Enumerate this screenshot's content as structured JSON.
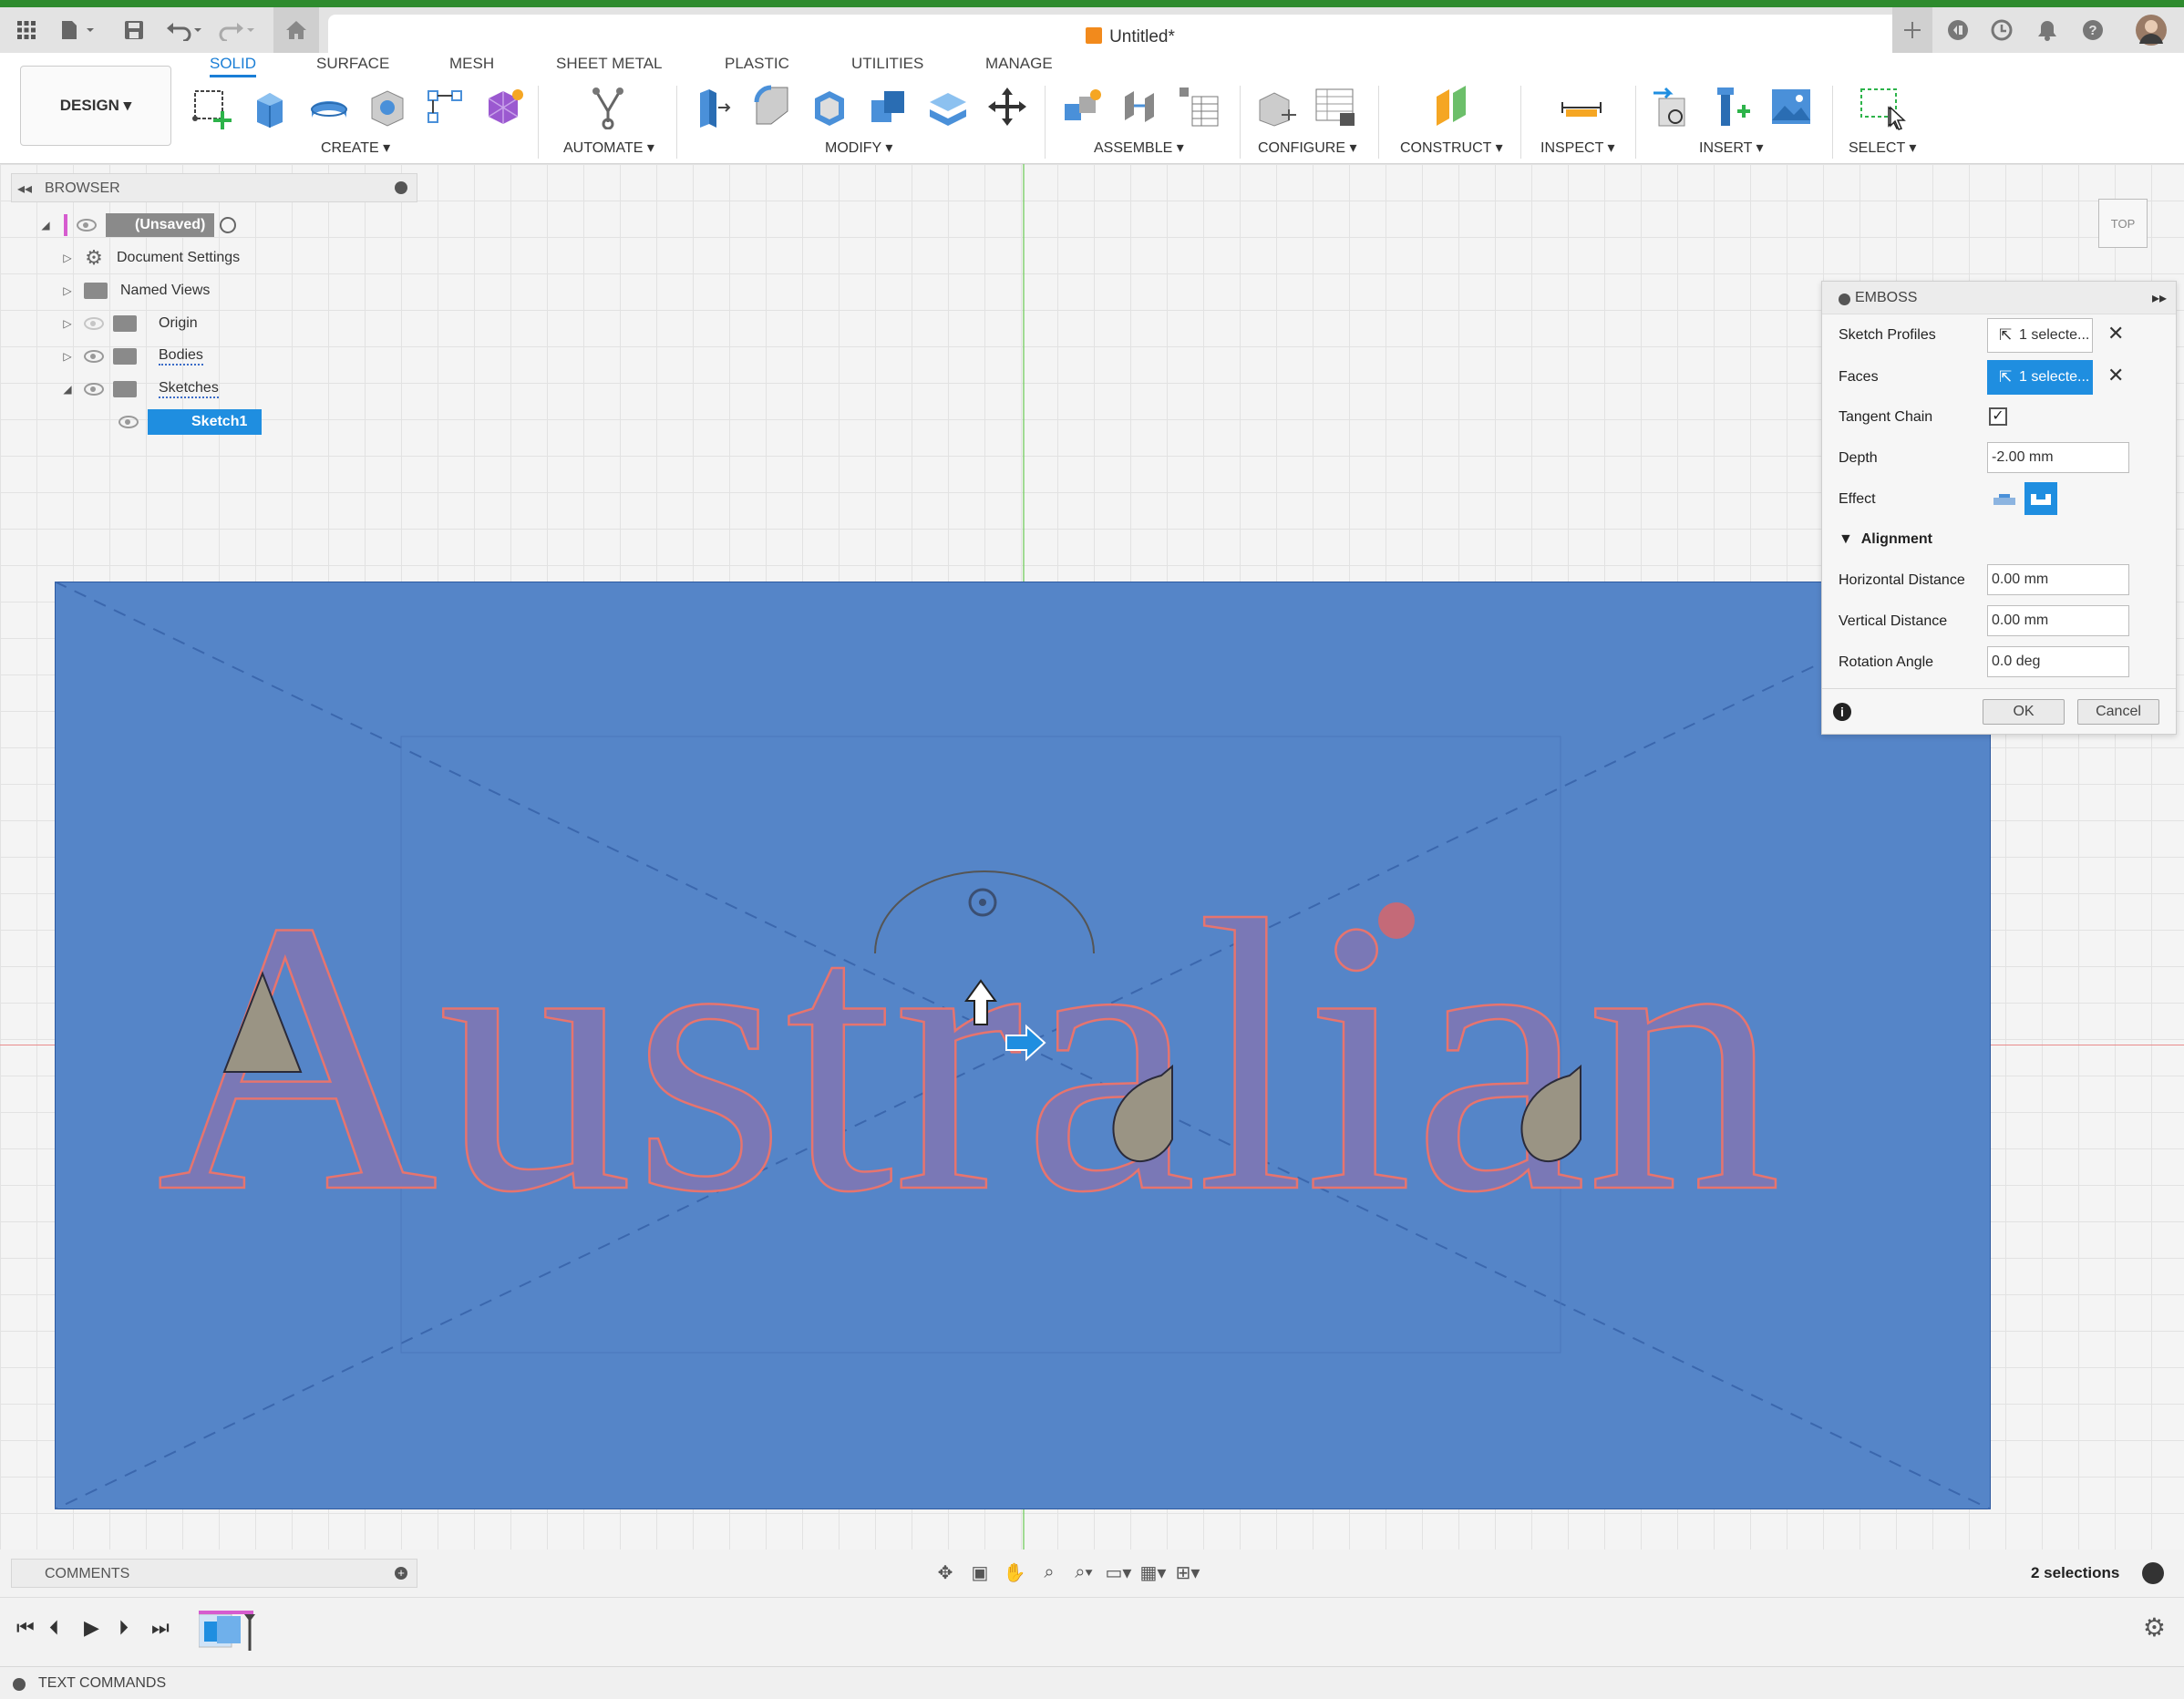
{
  "window": {
    "title": "Untitled*"
  },
  "titlebar_icons": [
    "apps-grid-icon",
    "file-icon",
    "save-icon",
    "undo-icon",
    "redo-icon",
    "home-icon",
    "new-tab-icon",
    "extensions-icon",
    "job-status-icon",
    "notifications-icon",
    "help-icon",
    "user-avatar"
  ],
  "workspace": {
    "label": "DESIGN"
  },
  "tabs": [
    "SOLID",
    "SURFACE",
    "MESH",
    "SHEET METAL",
    "PLASTIC",
    "UTILITIES",
    "MANAGE"
  ],
  "active_tab": "SOLID",
  "groups": [
    "CREATE",
    "AUTOMATE",
    "MODIFY",
    "ASSEMBLE",
    "CONFIGURE",
    "CONSTRUCT",
    "INSPECT",
    "INSERT",
    "SELECT"
  ],
  "browser": {
    "title": "BROWSER",
    "root": "(Unsaved)",
    "items": [
      "Document Settings",
      "Named Views",
      "Origin",
      "Bodies",
      "Sketches",
      "Sketch1"
    ]
  },
  "canvas": {
    "sketch_text": "Australian",
    "view_cube": "TOP",
    "plate_color": "#5585c8",
    "text_color": "#7a78b6"
  },
  "emboss": {
    "title": "EMBOSS",
    "sketch_profiles_label": "Sketch Profiles",
    "sketch_profiles_value": "1 selecte...",
    "faces_label": "Faces",
    "faces_value": "1 selecte...",
    "tangent_chain_label": "Tangent Chain",
    "tangent_chain_checked": true,
    "depth_label": "Depth",
    "depth_value": "-2.00 mm",
    "effect_label": "Effect",
    "alignment_label": "Alignment",
    "horizontal_label": "Horizontal Distance",
    "horizontal_value": "0.00 mm",
    "vertical_label": "Vertical Distance",
    "vertical_value": "0.00 mm",
    "rotation_label": "Rotation Angle",
    "rotation_value": "0.0 deg",
    "ok_label": "OK",
    "cancel_label": "Cancel",
    "accent": "#1f8ee0"
  },
  "comments": {
    "title": "COMMENTS"
  },
  "status": {
    "selections": "2 selections"
  },
  "text_commands": {
    "title": "TEXT COMMANDS"
  }
}
